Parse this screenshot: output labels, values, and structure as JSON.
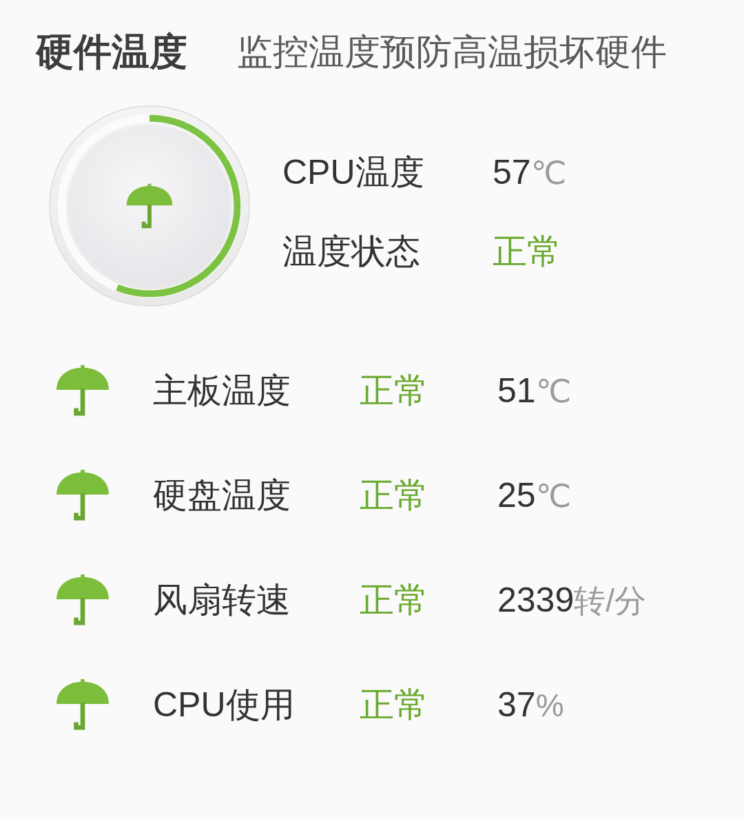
{
  "header": {
    "title": "硬件温度",
    "subtitle": "监控温度预防高温损坏硬件"
  },
  "cpu": {
    "gauge": {
      "level": 0.56
    },
    "stats": [
      {
        "kind": "reading",
        "label": "CPU温度",
        "value": "57",
        "unit": "℃"
      },
      {
        "kind": "status",
        "label": "温度状态",
        "value": "正常"
      }
    ]
  },
  "sensors": [
    {
      "label": "主板温度",
      "status": "正常",
      "value": "51",
      "unit": "℃"
    },
    {
      "label": "硬盘温度",
      "status": "正常",
      "value": "25",
      "unit": "℃"
    },
    {
      "label": "风扇转速",
      "status": "正常",
      "value": "2339",
      "unit": "转/分"
    },
    {
      "label": "CPU使用",
      "status": "正常",
      "value": "37",
      "unit": "%"
    }
  ]
}
